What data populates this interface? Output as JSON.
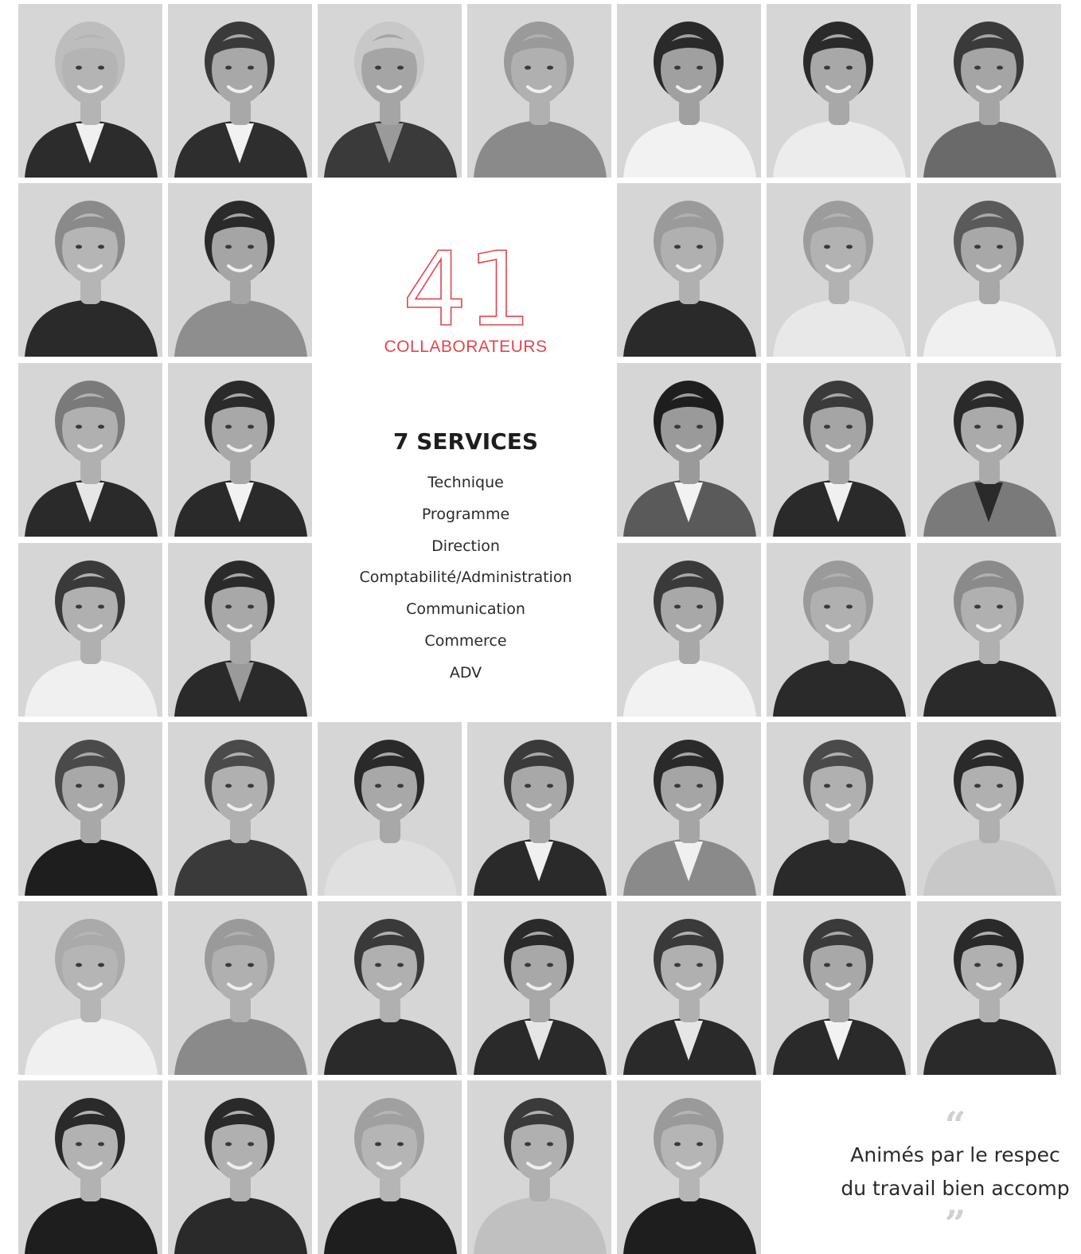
{
  "stats": {
    "count": "41",
    "count_label": "COLLABORATEURS",
    "services_title": "7 SERVICES",
    "services": [
      "Technique",
      "Programme",
      "Direction",
      "Comptabilité/Administration",
      "Communication",
      "Commerce",
      "ADV"
    ]
  },
  "quote": {
    "open_mark": "“",
    "line1": "Animés par le respec",
    "line2": "du travail bien accomp",
    "close_mark": "”"
  },
  "colors": {
    "accent": "#e3454c",
    "photo_background": "#d6d6d6",
    "text": "#2a2a2a"
  },
  "team_photos": [
    {
      "hair": "#bdbdbd",
      "skin": "#b4b4b4",
      "top": "#2c2c2c",
      "shirt": "#f0f0f0"
    },
    {
      "hair": "#3a3a3a",
      "skin": "#a8a8a8",
      "top": "#2e2e2e",
      "shirt": "#f2f2f2"
    },
    {
      "hair": "#c8c8c8",
      "skin": "#a5a5a5",
      "top": "#3a3a3a",
      "shirt": "#9a9a9a"
    },
    {
      "hair": "#9a9a9a",
      "skin": "#b0b0b0",
      "top": "#8a8a8a",
      "shirt": "#8a8a8a"
    },
    {
      "hair": "#2a2a2a",
      "skin": "#a0a0a0",
      "top": "#f2f2f2",
      "shirt": "#f2f2f2"
    },
    {
      "hair": "#2a2a2a",
      "skin": "#a8a8a8",
      "top": "#ececec",
      "shirt": "#ececec"
    },
    {
      "hair": "#3a3a3a",
      "skin": "#a5a5a5",
      "top": "#6a6a6a",
      "shirt": "#6a6a6a"
    },
    {
      "hair": "#8a8a8a",
      "skin": "#b5b5b5",
      "top": "#2a2a2a",
      "shirt": "#2a2a2a"
    },
    {
      "hair": "#2a2a2a",
      "skin": "#a5a5a5",
      "top": "#8e8e8e",
      "shirt": "#8e8e8e"
    },
    {
      "hair": "#9a9a9a",
      "skin": "#b0b0b0",
      "top": "#2a2a2a",
      "shirt": "#2a2a2a"
    },
    {
      "hair": "#9c9c9c",
      "skin": "#b2b2b2",
      "top": "#e8e8e8",
      "shirt": "#e8e8e8"
    },
    {
      "hair": "#5a5a5a",
      "skin": "#a8a8a8",
      "top": "#f0f0f0",
      "shirt": "#f0f0f0"
    },
    {
      "hair": "#7a7a7a",
      "skin": "#b0b0b0",
      "top": "#2a2a2a",
      "shirt": "#e6e6e6"
    },
    {
      "hair": "#2a2a2a",
      "skin": "#a8a8a8",
      "top": "#2a2a2a",
      "shirt": "#f2f2f2"
    },
    {
      "hair": "#1e1e1e",
      "skin": "#9a9a9a",
      "top": "#5a5a5a",
      "shirt": "#f2f2f2"
    },
    {
      "hair": "#3a3a3a",
      "skin": "#a5a5a5",
      "top": "#2a2a2a",
      "shirt": "#f0f0f0"
    },
    {
      "hair": "#2a2a2a",
      "skin": "#aaaaaa",
      "top": "#7a7a7a",
      "shirt": "#2a2a2a"
    },
    {
      "hair": "#3a3a3a",
      "skin": "#b0b0b0",
      "top": "#f0f0f0",
      "shirt": "#f0f0f0"
    },
    {
      "hair": "#2a2a2a",
      "skin": "#a8a8a8",
      "top": "#2a2a2a",
      "shirt": "#9a9a9a"
    },
    {
      "hair": "#3a3a3a",
      "skin": "#a8a8a8",
      "top": "#f2f2f2",
      "shirt": "#f2f2f2"
    },
    {
      "hair": "#9a9a9a",
      "skin": "#b0b0b0",
      "top": "#2a2a2a",
      "shirt": "#2a2a2a"
    },
    {
      "hair": "#8a8a8a",
      "skin": "#b0b0b0",
      "top": "#2a2a2a",
      "shirt": "#2a2a2a"
    },
    {
      "hair": "#4a4a4a",
      "skin": "#a8a8a8",
      "top": "#1e1e1e",
      "shirt": "#1e1e1e"
    },
    {
      "hair": "#4a4a4a",
      "skin": "#b0b0b0",
      "top": "#3a3a3a",
      "shirt": "#3a3a3a"
    },
    {
      "hair": "#2a2a2a",
      "skin": "#a8a8a8",
      "top": "#e0e0e0",
      "shirt": "#e0e0e0"
    },
    {
      "hair": "#3a3a3a",
      "skin": "#a8a8a8",
      "top": "#2a2a2a",
      "shirt": "#f0f0f0"
    },
    {
      "hair": "#2a2a2a",
      "skin": "#a5a5a5",
      "top": "#8a8a8a",
      "shirt": "#f0f0f0"
    },
    {
      "hair": "#4a4a4a",
      "skin": "#b0b0b0",
      "top": "#2a2a2a",
      "shirt": "#2a2a2a"
    },
    {
      "hair": "#2a2a2a",
      "skin": "#b0b0b0",
      "top": "#c8c8c8",
      "shirt": "#c8c8c8"
    },
    {
      "hair": "#aaaaaa",
      "skin": "#b5b5b5",
      "top": "#f0f0f0",
      "shirt": "#f0f0f0"
    },
    {
      "hair": "#9a9a9a",
      "skin": "#b0b0b0",
      "top": "#8a8a8a",
      "shirt": "#8a8a8a"
    },
    {
      "hair": "#3a3a3a",
      "skin": "#b0b0b0",
      "top": "#2a2a2a",
      "shirt": "#2a2a2a"
    },
    {
      "hair": "#2a2a2a",
      "skin": "#a8a8a8",
      "top": "#2a2a2a",
      "shirt": "#e6e6e6"
    },
    {
      "hair": "#3a3a3a",
      "skin": "#b0b0b0",
      "top": "#2a2a2a",
      "shirt": "#e6e6e6"
    },
    {
      "hair": "#3a3a3a",
      "skin": "#a8a8a8",
      "top": "#2a2a2a",
      "shirt": "#f2f2f2"
    },
    {
      "hair": "#2a2a2a",
      "skin": "#b0b0b0",
      "top": "#2a2a2a",
      "shirt": "#2a2a2a"
    },
    {
      "hair": "#2a2a2a",
      "skin": "#b2b2b2",
      "top": "#1e1e1e",
      "shirt": "#1e1e1e"
    },
    {
      "hair": "#2a2a2a",
      "skin": "#b0b0b0",
      "top": "#2a2a2a",
      "shirt": "#2a2a2a"
    },
    {
      "hair": "#a0a0a0",
      "skin": "#b5b5b5",
      "top": "#1e1e1e",
      "shirt": "#1e1e1e"
    },
    {
      "hair": "#3a3a3a",
      "skin": "#b0b0b0",
      "top": "#c0c0c0",
      "shirt": "#c0c0c0"
    },
    {
      "hair": "#9a9a9a",
      "skin": "#b5b5b5",
      "top": "#1e1e1e",
      "shirt": "#1e1e1e"
    }
  ]
}
